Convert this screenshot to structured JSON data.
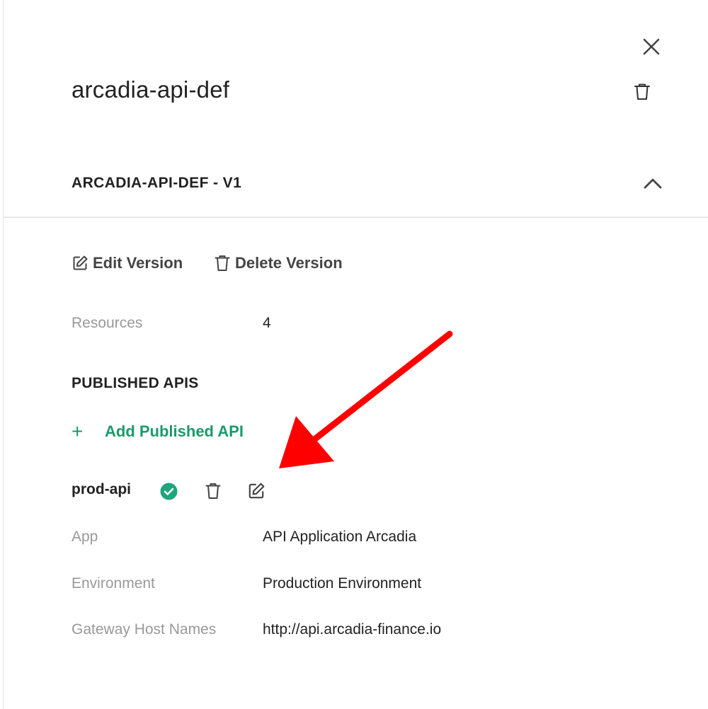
{
  "panel": {
    "title": "arcadia-api-def",
    "close_icon": "close-icon",
    "delete_icon": "trash-icon"
  },
  "version_section": {
    "title": "ARCADIA-API-DEF - V1",
    "expanded": true,
    "collapse_icon": "chevron-up-icon",
    "actions": {
      "edit_label": "Edit Version",
      "delete_label": "Delete Version"
    },
    "resources_label": "Resources",
    "resources_value": "4"
  },
  "published_apis": {
    "title": "PUBLISHED APIS",
    "add_label": "Add Published API",
    "add_icon": "plus-icon",
    "items": [
      {
        "name": "prod-api",
        "status_icon": "check-circle-icon",
        "fields": [
          {
            "label": "App",
            "value": "API Application Arcadia"
          },
          {
            "label": "Environment",
            "value": "Production Environment"
          },
          {
            "label": "Gateway Host Names",
            "value": "http://api.arcadia-finance.io"
          }
        ]
      }
    ]
  },
  "colors": {
    "accent_green": "#1a9a6c",
    "status_green": "#1fa67a",
    "annotation_red": "#ff0000",
    "label_gray": "#999999",
    "text_dark": "#222222"
  }
}
